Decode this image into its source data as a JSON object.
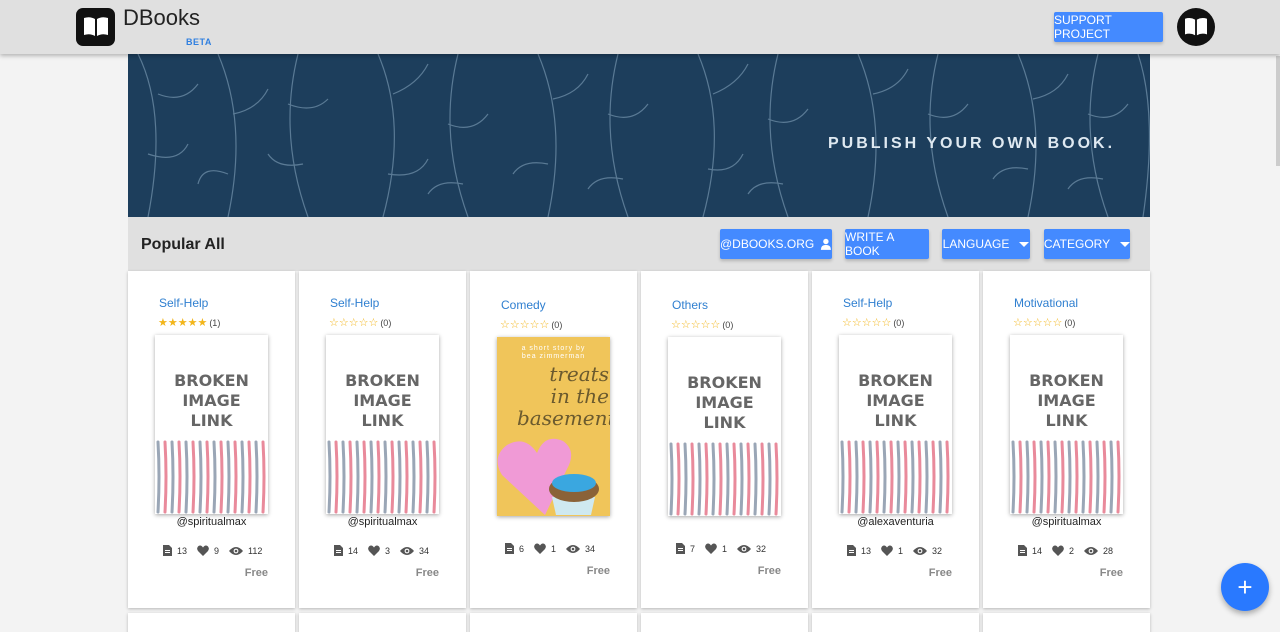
{
  "header": {
    "brand": "DBooks",
    "beta": "BETA",
    "support_label": "SUPPORT PROJECT"
  },
  "banner": {
    "text": "PUBLISH YOUR OWN BOOK."
  },
  "filters": {
    "title": "Popular All",
    "account_label": "@DBOOKS.ORG",
    "write_label": "WRITE A BOOK",
    "language_label": "LANGUAGE",
    "category_label": "CATEGORY"
  },
  "books": [
    {
      "category": "Self-Help",
      "stars": "★★★★★",
      "rating_count": "(1)",
      "cover": "broken",
      "author": "@spiritualmax",
      "pages": "13",
      "likes": "9",
      "views": "112",
      "price": "Free"
    },
    {
      "category": "Self-Help",
      "stars": "☆☆☆☆☆",
      "rating_count": "(0)",
      "cover": "broken",
      "author": "@spiritualmax",
      "pages": "14",
      "likes": "3",
      "views": "34",
      "price": "Free"
    },
    {
      "category": "Comedy",
      "stars": "☆☆☆☆☆",
      "rating_count": "(0)",
      "cover": "treats",
      "author": "",
      "pages": "6",
      "likes": "1",
      "views": "34",
      "price": "Free"
    },
    {
      "category": "Others",
      "stars": "☆☆☆☆☆",
      "rating_count": "(0)",
      "cover": "broken",
      "author": "",
      "pages": "7",
      "likes": "1",
      "views": "32",
      "price": "Free"
    },
    {
      "category": "Self-Help",
      "stars": "☆☆☆☆☆",
      "rating_count": "(0)",
      "cover": "broken",
      "author": "@alexaventuria",
      "pages": "13",
      "likes": "1",
      "views": "32",
      "price": "Free"
    },
    {
      "category": "Motivational",
      "stars": "☆☆☆☆☆",
      "rating_count": "(0)",
      "cover": "broken",
      "author": "@spiritualmax",
      "pages": "14",
      "likes": "2",
      "views": "28",
      "price": "Free"
    }
  ],
  "broken_cover_text": [
    "BROKEN",
    "IMAGE",
    "LINK"
  ],
  "treats_cover": {
    "small_line1": "a short story by",
    "small_line2": "bea zimmerman",
    "title_line1": "treats",
    "title_line2": "in the",
    "title_line3": "basement"
  },
  "fab_label": "+",
  "colors": {
    "accent": "#448aff",
    "banner": "#1d3e5c",
    "link": "#2f7fd0",
    "star": "#f2b51a"
  }
}
